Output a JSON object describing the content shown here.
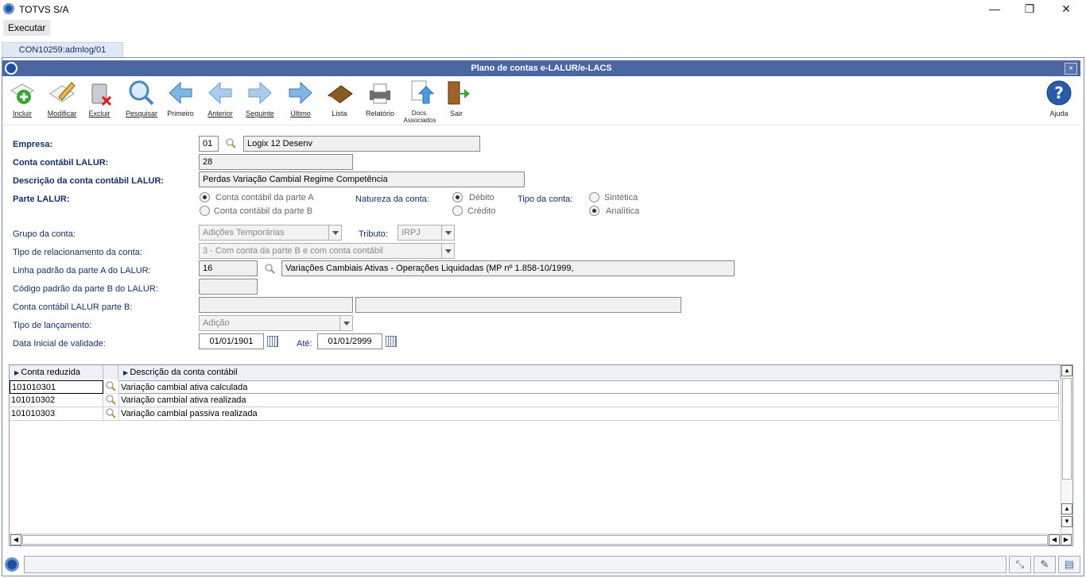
{
  "window": {
    "app_title": "TOTVS S/A",
    "minimize": "—",
    "restore": "❐",
    "close": "✕"
  },
  "menu": {
    "executar": "Executar"
  },
  "tab": {
    "label": "CON10259:admlog/01"
  },
  "panel": {
    "title": "Plano de contas e-LALUR/e-LACS",
    "close": "×"
  },
  "toolbar": {
    "incluir": "Incluir",
    "modificar": "Modificar",
    "excluir": "Excluir",
    "pesquisar": "Pesquisar",
    "primeiro": "Primeiro",
    "anterior": "Anterior",
    "seguinte": "Seguinte",
    "ultimo": "Último",
    "lista": "Lista",
    "relatorio": "Relatório",
    "docs_line1": "Docs.",
    "docs_line2": "Associados",
    "sair": "Sair",
    "ajuda": "Ajuda"
  },
  "form": {
    "empresa_label": "Empresa:",
    "empresa_code": "01",
    "empresa_name": "Logix 12 Desenv",
    "conta_label": "Conta contábil LALUR:",
    "conta_value": "28",
    "descricao_label": "Descrição da conta contábil LALUR:",
    "descricao_value": "Perdas Variação Cambial Regime Competência",
    "parte_label": "Parte LALUR:",
    "parte_a": "Conta contábil da parte A",
    "parte_b": "Conta contábil da parte B",
    "natureza_label": "Natureza da conta:",
    "debito": "Débito",
    "credito": "Crédito",
    "tipo_conta_label": "Tipo da conta:",
    "sintetica": "Sintética",
    "analitica": "Analítica",
    "grupo_label": "Grupo da conta:",
    "grupo_value": "Adições Temporárias",
    "tributo_label": "Tributo:",
    "tributo_value": "IRPJ",
    "tipo_rel_label": "Tipo de relacionamento da conta:",
    "tipo_rel_value": "3 - Com conta da parte B e com conta contábil",
    "linha_label": "Linha padrão da parte A do LALUR:",
    "linha_code": "16",
    "linha_desc": "Variações Cambiais Ativas - Operações Liquidadas (MP nº 1.858-10/1999,",
    "codigo_b_label": "Código padrão da parte B do LALUR:",
    "codigo_b_value": "",
    "conta_b_label": "Conta contábil LALUR parte B:",
    "conta_b_code": "",
    "conta_b_desc": "",
    "tipo_lanc_label": "Tipo de lançamento:",
    "tipo_lanc_value": "Adição",
    "data_label": "Data Inicial de validade:",
    "data_inicial": "01/01/1901",
    "ate_label": "Até:",
    "data_final": "01/01/2999"
  },
  "grid": {
    "col1": "Conta reduzida",
    "col2": "Descrição da conta contábil",
    "rows": [
      {
        "conta": "101010301",
        "descricao": "Variação cambial ativa calculada"
      },
      {
        "conta": "101010302",
        "descricao": "Variação cambial ativa realizada"
      },
      {
        "conta": "101010303",
        "descricao": "Variação cambial passiva realizada"
      }
    ]
  },
  "status": {
    "text": ""
  },
  "colors": {
    "accent": "#4a66a3",
    "label": "#14306a"
  }
}
